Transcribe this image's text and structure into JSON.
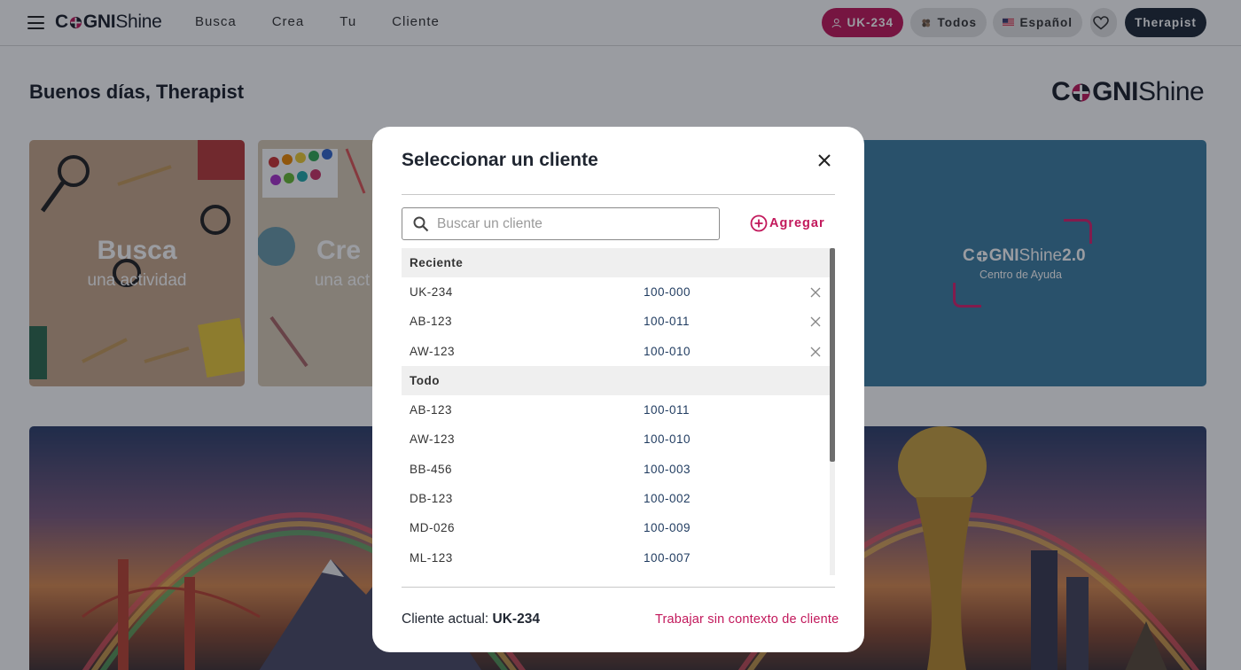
{
  "topbar": {
    "logo": {
      "pre": "C",
      "mid": "GNI",
      "post": "Shine"
    },
    "nav": [
      "Busca",
      "Crea",
      "Tu",
      "Cliente"
    ],
    "client_pill": "UK-234",
    "todos_pill": "Todos",
    "lang_pill": "Español",
    "user_pill": "Therapist"
  },
  "page": {
    "greeting": "Buenos días, Therapist",
    "big_logo": {
      "pre": "C",
      "mid": "GNI",
      "post": "Shine"
    },
    "cards": {
      "busca": {
        "title": "Busca",
        "sub": "una actividad"
      },
      "crea": {
        "title": "Cre",
        "sub": "una act"
      },
      "help": {
        "logo_pre": "C",
        "logo_mid": "GNI",
        "logo_post": "Shine ",
        "version": "2.0",
        "sub": "Centro de Ayuda"
      }
    }
  },
  "modal": {
    "title": "Seleccionar un cliente",
    "search_placeholder": "Buscar un cliente",
    "add_label": "Agregar",
    "sections": {
      "recent_header": "Reciente",
      "recent": [
        {
          "code": "UK-234",
          "num": "100-000"
        },
        {
          "code": "AB-123",
          "num": "100-011"
        },
        {
          "code": "AW-123",
          "num": "100-010"
        }
      ],
      "all_header": "Todo",
      "all": [
        {
          "code": "AB-123",
          "num": "100-011"
        },
        {
          "code": "AW-123",
          "num": "100-010"
        },
        {
          "code": "BB-456",
          "num": "100-003"
        },
        {
          "code": "DB-123",
          "num": "100-002"
        },
        {
          "code": "MD-026",
          "num": "100-009"
        },
        {
          "code": "ML-123",
          "num": "100-007"
        }
      ]
    },
    "footer": {
      "current_label": "Cliente actual: ",
      "current_value": "UK-234",
      "link": "Trabajar sin contexto de cliente"
    }
  },
  "colors": {
    "accent": "#c2185b",
    "dark": "#1e2836",
    "help_bg": "#3d7fa3"
  }
}
